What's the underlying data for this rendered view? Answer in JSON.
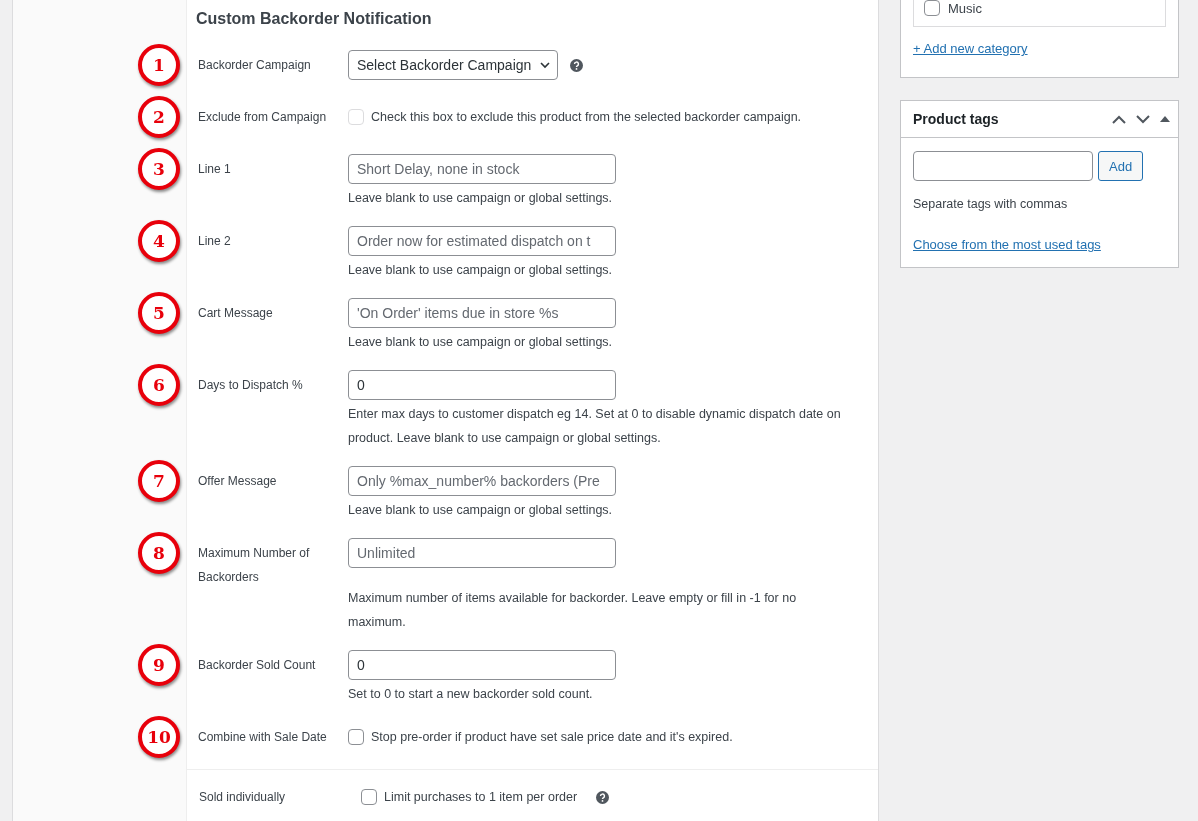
{
  "section": {
    "title": "Custom Backorder Notification",
    "fields": [
      {
        "marker": "1",
        "label": "Backorder Campaign",
        "kind": "select",
        "value": "Select Backorder Campaign",
        "help": true
      },
      {
        "marker": "2",
        "label": "Exclude from Campaign",
        "kind": "checkbox",
        "checked": false,
        "disabled": true,
        "text": "Check this box to exclude this product from the selected backorder campaign."
      },
      {
        "marker": "3",
        "label": "Line 1",
        "kind": "text",
        "placeholder": "Short Delay, none in stock",
        "description": "Leave blank to use campaign or global settings."
      },
      {
        "marker": "4",
        "label": "Line 2",
        "kind": "text",
        "placeholder": "Order now for estimated dispatch on t",
        "description": "Leave blank to use campaign or global settings."
      },
      {
        "marker": "5",
        "label": "Cart Message",
        "kind": "text",
        "placeholder": "'On Order' items due in store %s",
        "description": "Leave blank to use campaign or global settings."
      },
      {
        "marker": "6",
        "label": "Days to Dispatch %",
        "kind": "text",
        "value": "0",
        "description": "Enter max days to customer dispatch eg 14. Set at 0 to disable dynamic dispatch date on product. Leave blank to use campaign or global settings."
      },
      {
        "marker": "7",
        "label": "Offer Message",
        "kind": "text",
        "placeholder": "Only %max_number% backorders (Pre",
        "description": "Leave blank to use campaign or global settings."
      },
      {
        "marker": "8",
        "label": "Maximum Number of Backorders",
        "kind": "text_note",
        "placeholder": "Unlimited",
        "description": "Maximum number of items available for backorder. Leave empty or fill in -1 for no maximum."
      },
      {
        "marker": "9",
        "label": "Backorder Sold Count",
        "kind": "text",
        "value": "0",
        "description": "Set to 0 to start a new backorder sold count."
      },
      {
        "marker": "10",
        "label": "Combine with Sale Date",
        "kind": "checkbox",
        "checked": false,
        "disabled": false,
        "text": "Stop pre-order if product have set sale price date and it's expired."
      },
      {
        "label": "Sold individually",
        "kind": "checkbox",
        "checked": false,
        "disabled": false,
        "text": "Limit purchases to 1 item per order",
        "help": true
      }
    ]
  },
  "sidebar": {
    "categories": {
      "items": [
        {
          "label": "Music",
          "checked": false
        }
      ],
      "add_link": "+ Add new category"
    },
    "tags": {
      "title": "Product tags",
      "add_button": "Add",
      "hint": "Separate tags with commas",
      "link": "Choose from the most used tags"
    }
  }
}
